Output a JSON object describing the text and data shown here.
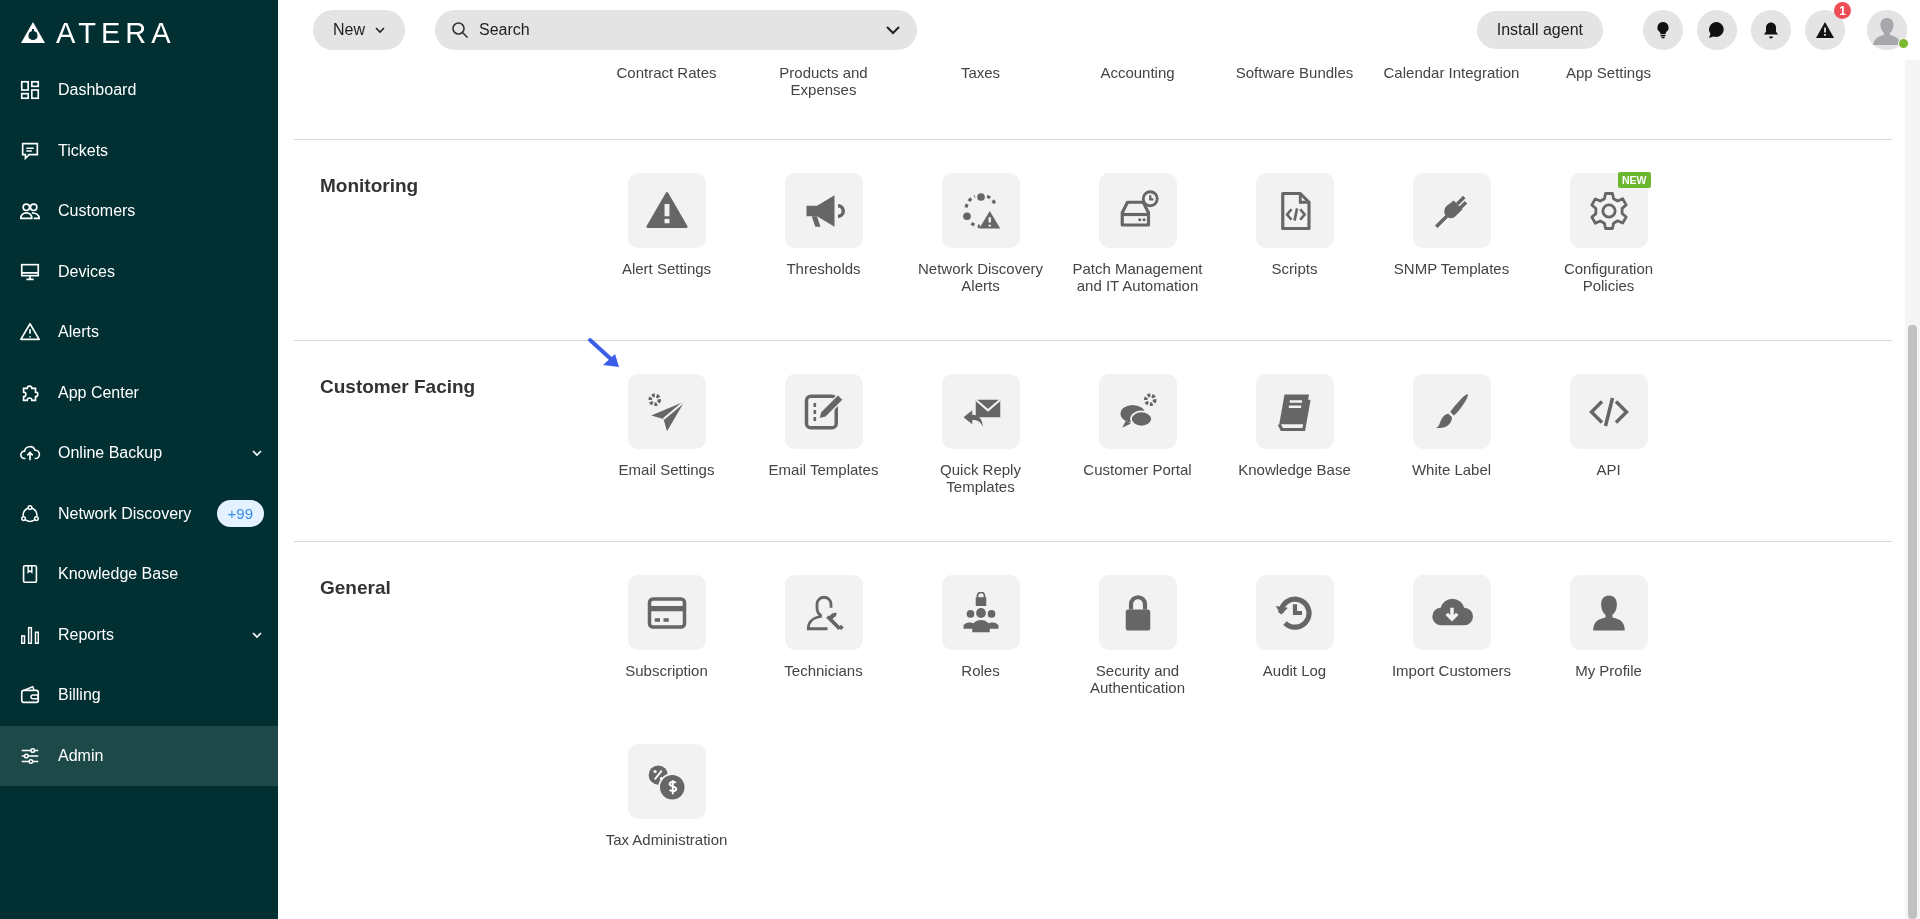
{
  "sidebar": {
    "logo": "ATERA",
    "items": [
      {
        "label": "Dashboard",
        "kind": "link",
        "selected": false
      },
      {
        "label": "Tickets",
        "kind": "link",
        "selected": false
      },
      {
        "label": "Customers",
        "kind": "link",
        "selected": false
      },
      {
        "label": "Devices",
        "kind": "link",
        "selected": false
      },
      {
        "label": "Alerts",
        "kind": "link",
        "selected": false
      },
      {
        "label": "App Center",
        "kind": "link",
        "selected": false
      },
      {
        "label": "Online Backup",
        "kind": "group",
        "selected": false
      },
      {
        "label": "Network Discovery",
        "kind": "link",
        "selected": false,
        "badge": "+99"
      },
      {
        "label": "Knowledge Base",
        "kind": "link",
        "selected": false
      },
      {
        "label": "Reports",
        "kind": "group",
        "selected": false
      },
      {
        "label": "Billing",
        "kind": "link",
        "selected": false
      },
      {
        "label": "Admin",
        "kind": "link",
        "selected": true
      }
    ]
  },
  "topbar": {
    "new_button": "New",
    "search": {
      "placeholder": "Search"
    },
    "install_button": "Install agent",
    "alerts_badge": "1",
    "avatar": {
      "online": true
    }
  },
  "sections": [
    {
      "kind": "scrolled",
      "items": [
        {
          "label": "Contract Rates"
        },
        {
          "label": "Products and Expenses"
        },
        {
          "label": "Taxes"
        },
        {
          "label": "Accounting"
        },
        {
          "label": "Software Bundles"
        },
        {
          "label": "Calendar Integration"
        },
        {
          "label": "App Settings"
        }
      ]
    },
    {
      "kind": "full",
      "title": "Monitoring",
      "items": [
        {
          "label": "Alert Settings",
          "pointed": false
        },
        {
          "label": "Thresholds",
          "pointed": false
        },
        {
          "label": "Network Discovery Alerts",
          "pointed": false
        },
        {
          "label": "Patch Management and IT Automation",
          "pointed": false
        },
        {
          "label": "Scripts",
          "pointed": false
        },
        {
          "label": "SNMP Templates",
          "pointed": false
        },
        {
          "label": "Configuration Policies",
          "pointed": false,
          "badge": "NEW"
        }
      ]
    },
    {
      "kind": "full",
      "title": "Customer Facing",
      "items": [
        {
          "label": "Email Settings",
          "pointed": true
        },
        {
          "label": "Email Templates",
          "pointed": false
        },
        {
          "label": "Quick Reply Templates",
          "pointed": false
        },
        {
          "label": "Customer Portal",
          "pointed": false
        },
        {
          "label": "Knowledge Base",
          "pointed": false
        },
        {
          "label": "White Label",
          "pointed": false
        },
        {
          "label": "API",
          "pointed": false
        }
      ]
    },
    {
      "kind": "full",
      "title": "General",
      "items": [
        {
          "label": "Subscription",
          "pointed": false
        },
        {
          "label": "Technicians",
          "pointed": false
        },
        {
          "label": "Roles",
          "pointed": false
        },
        {
          "label": "Security and Authentication",
          "pointed": false
        },
        {
          "label": "Audit Log",
          "pointed": false
        },
        {
          "label": "Import Customers",
          "pointed": false
        },
        {
          "label": "My Profile",
          "pointed": false
        },
        {
          "label": "Tax Administration",
          "pointed": false
        }
      ]
    }
  ]
}
